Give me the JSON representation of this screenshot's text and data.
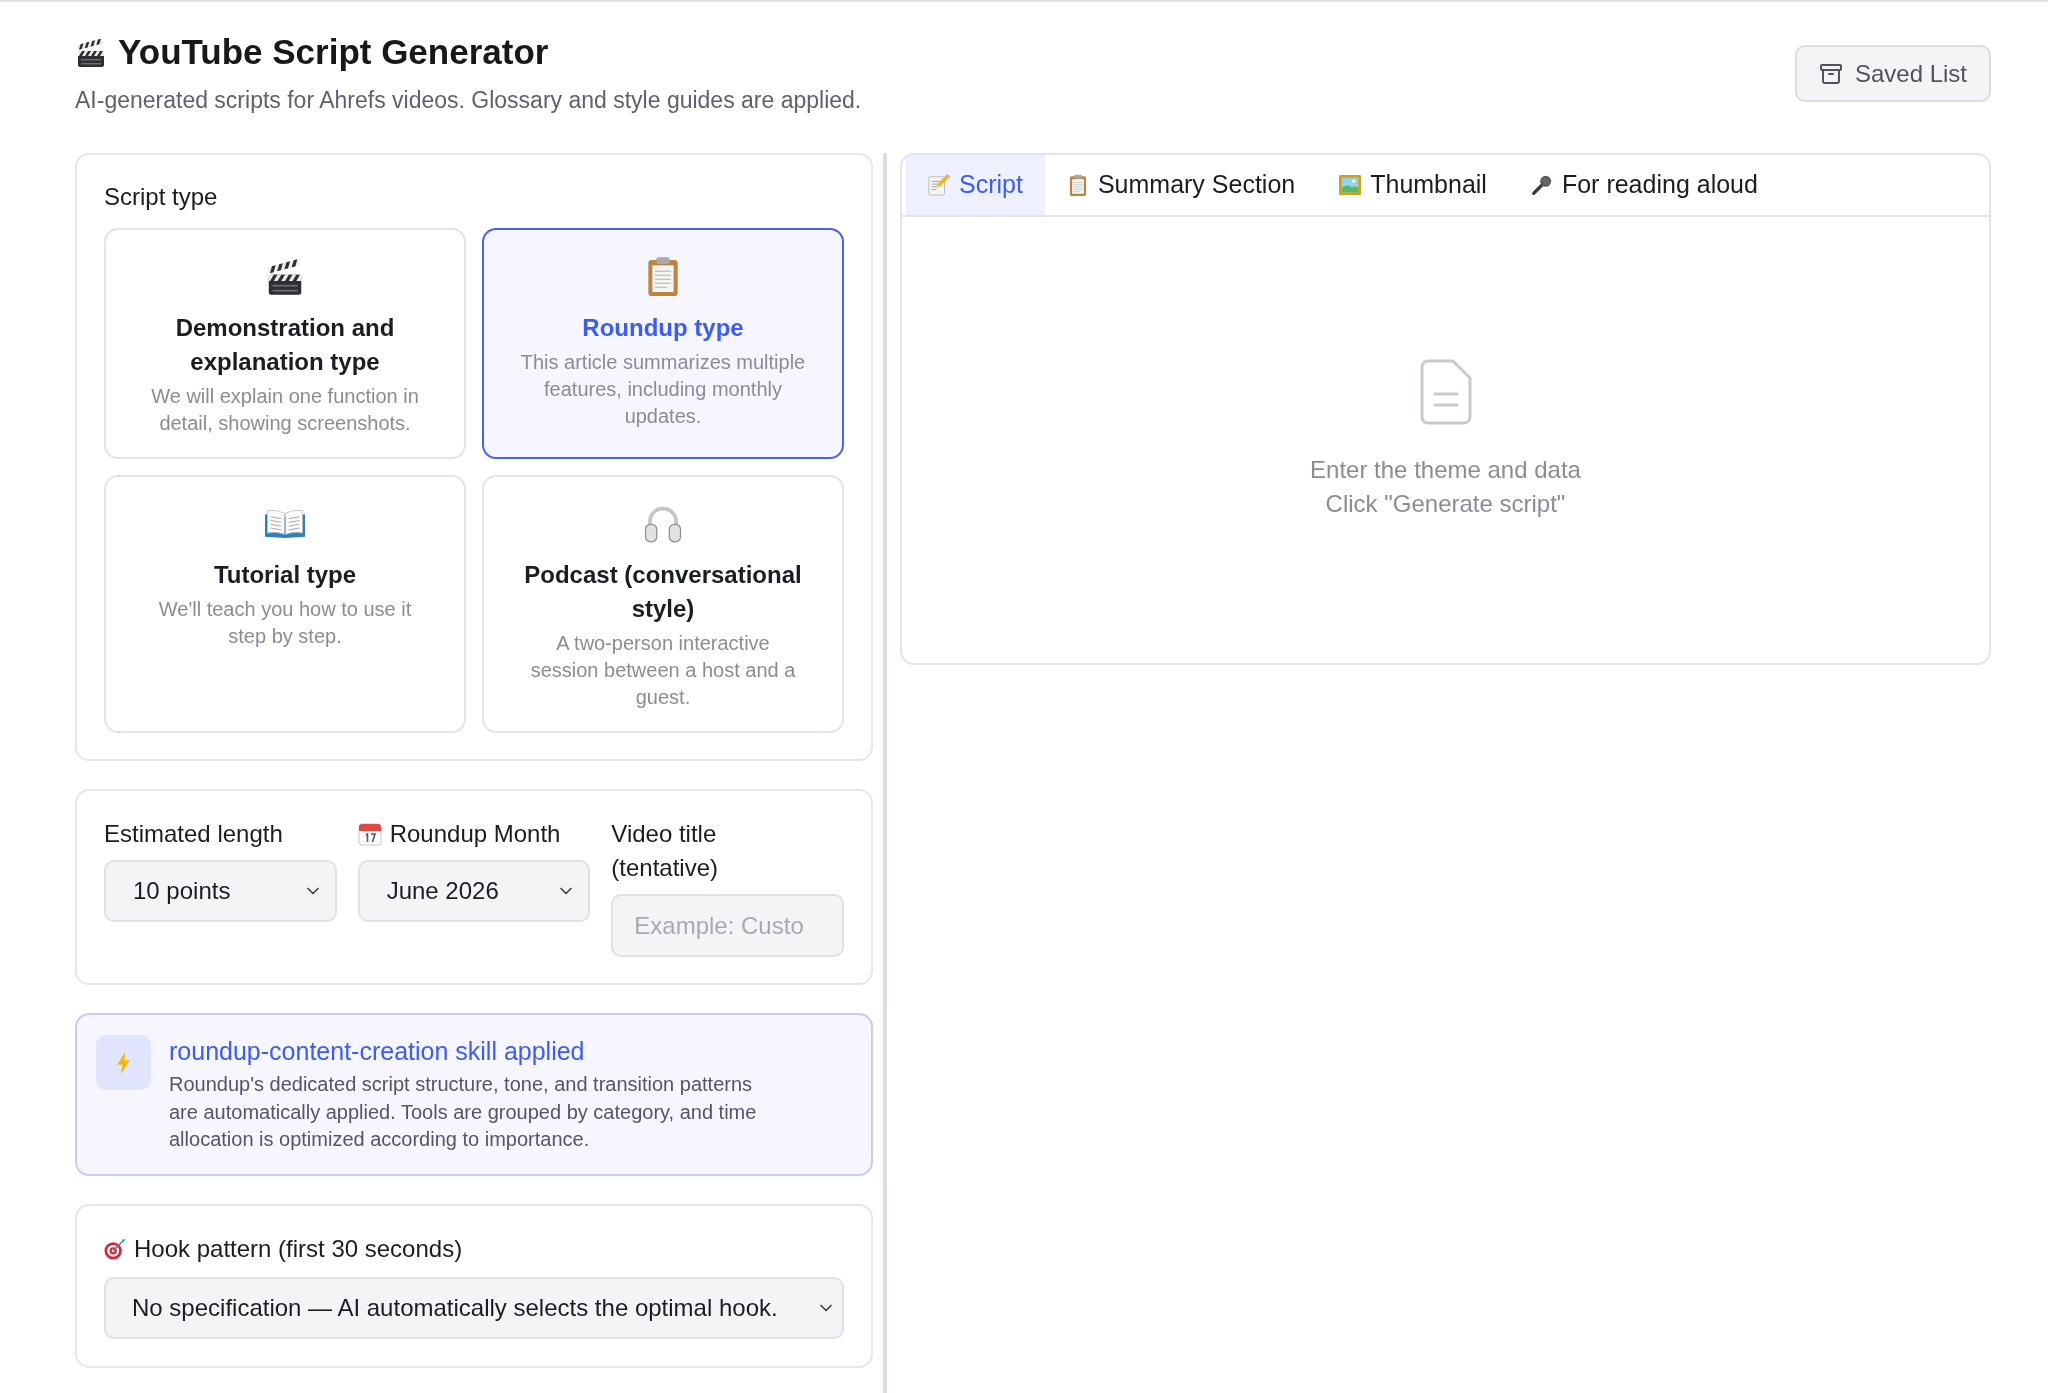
{
  "header": {
    "title": "YouTube Script Generator",
    "subtitle": "AI-generated scripts for Ahrefs videos. Glossary and style guides are applied.",
    "saved_button": "Saved List"
  },
  "script_type": {
    "label": "Script type",
    "options": [
      {
        "title": "Demonstration and explanation type",
        "description": "We will explain one function in detail, showing screenshots.",
        "selected": false
      },
      {
        "title": "Roundup type",
        "description": "This article summarizes multiple features, including monthly updates.",
        "selected": true
      },
      {
        "title": "Tutorial type",
        "description": "We'll teach you how to use it step by step.",
        "selected": false
      },
      {
        "title": "Podcast (conversational style)",
        "description": "A two-person interactive session between a host and a guest.",
        "selected": false
      }
    ]
  },
  "settings": {
    "fields": [
      {
        "kind": "select",
        "label": "Estimated length",
        "value": "10 points"
      },
      {
        "kind": "select",
        "label": "Roundup Month",
        "value": "June 2026"
      },
      {
        "kind": "input",
        "label": "Video title (tentative)",
        "placeholder": "Example: Custo"
      }
    ]
  },
  "skill_notice": {
    "title": "roundup-content-creation skill applied",
    "description": "Roundup's dedicated script structure, tone, and transition patterns are automatically applied. Tools are grouped by category, and time allocation is optimized according to importance."
  },
  "hook": {
    "label": "Hook pattern (first 30 seconds)",
    "value": "No specification — AI automatically selects the optimal hook."
  },
  "output": {
    "tabs": [
      {
        "label": "Script",
        "selected": true
      },
      {
        "label": "Summary Section",
        "selected": false
      },
      {
        "label": "Thumbnail",
        "selected": false
      },
      {
        "label": "For reading aloud",
        "selected": false
      }
    ],
    "empty_state": {
      "lines": [
        "Enter the theme and data",
        "Click \"Generate script\""
      ]
    }
  }
}
